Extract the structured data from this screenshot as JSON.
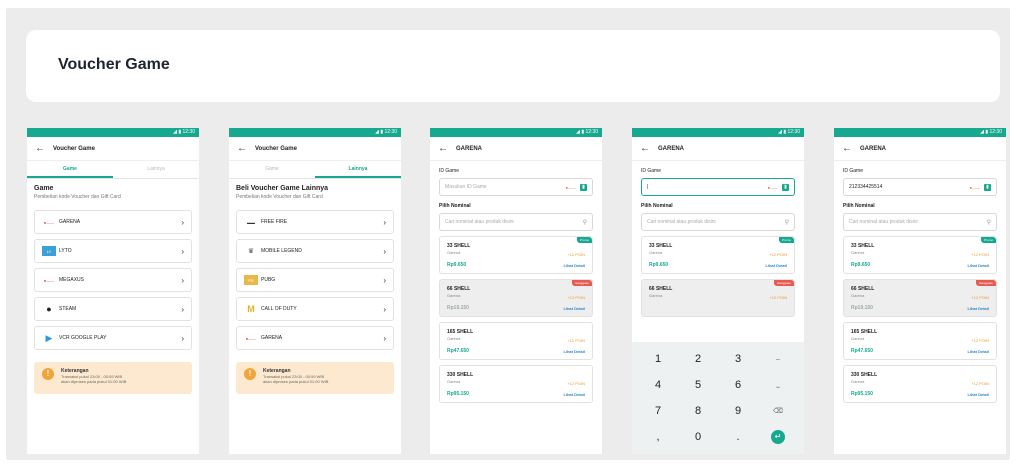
{
  "page": {
    "title": "Voucher Game"
  },
  "status_time": "12:30",
  "screen1": {
    "appbar_title": "Voucher Game",
    "tabs": [
      "Game",
      "Lainnya"
    ],
    "section_title": "Game",
    "section_sub": "Pembelian kode Voucher dan Gift Card",
    "items": [
      "GARENA",
      "LYTO",
      "MEGAXUS",
      "STEAM",
      "VCR GOOGLE PLAY"
    ],
    "note_title": "Keterangan",
    "note_line1": "Transaksi pukul 23:00 - 00:59 WIB",
    "note_line2": "akan diproses pada pukul 01:00 WIB"
  },
  "screen2": {
    "appbar_title": "Voucher Game",
    "tabs": [
      "Game",
      "Lainnya"
    ],
    "section_title": "Beli Voucher Game Lainnya",
    "section_sub": "Pembelian kode Voucher dan Gift Card",
    "items": [
      "FREE FIRE",
      "MOBILE LEGEND",
      "PUBG",
      "CALL OF DUTY",
      "GARENA"
    ],
    "note_title": "Keterangan",
    "note_line1": "Transaksi pukul 23:00 - 00:59 WIB",
    "note_line2": "akan diproses pada pukul 01:00 WIB"
  },
  "garena": {
    "appbar_title": "GARENA",
    "id_label": "ID Game",
    "id_placeholder": "Masukan ID Game",
    "id_typed": "|",
    "id_filled": "212334425514",
    "nominal_label": "Pilih Nominal",
    "search_placeholder": "Cari nominal atau produk disini",
    "products": [
      {
        "name": "33 SHELL",
        "provider": "Garena",
        "poin": "+12 POIN",
        "price": "Rp9.650",
        "detail": "Lihat Detail",
        "badge": "Promo",
        "soldout": false
      },
      {
        "name": "66 SHELL",
        "provider": "Garena",
        "poin": "+12 POIN",
        "price": "Rp19.150",
        "detail": "Lihat Detail",
        "badge": "Gangguan",
        "soldout": true
      },
      {
        "name": "165 SHELL",
        "provider": "Garena",
        "poin": "+12 POIN",
        "price": "Rp47.650",
        "detail": "Lihat Detail",
        "badge": "",
        "soldout": false
      },
      {
        "name": "330 SHELL",
        "provider": "Garena",
        "poin": "+12 POIN",
        "price": "Rp95.150",
        "detail": "Lihat Detail",
        "badge": "",
        "soldout": false
      }
    ]
  },
  "keyboard": {
    "keys": [
      "1",
      "2",
      "3",
      "–",
      "4",
      "5",
      "6",
      "⎵",
      "7",
      "8",
      "9",
      "⌫",
      ",",
      "0",
      ".",
      "↵"
    ]
  },
  "colors": {
    "accent": "#17a990",
    "promo": "#17a990",
    "soldout": "#e85a4f",
    "note_bg": "#fde9cf",
    "link": "#2a86c8"
  }
}
